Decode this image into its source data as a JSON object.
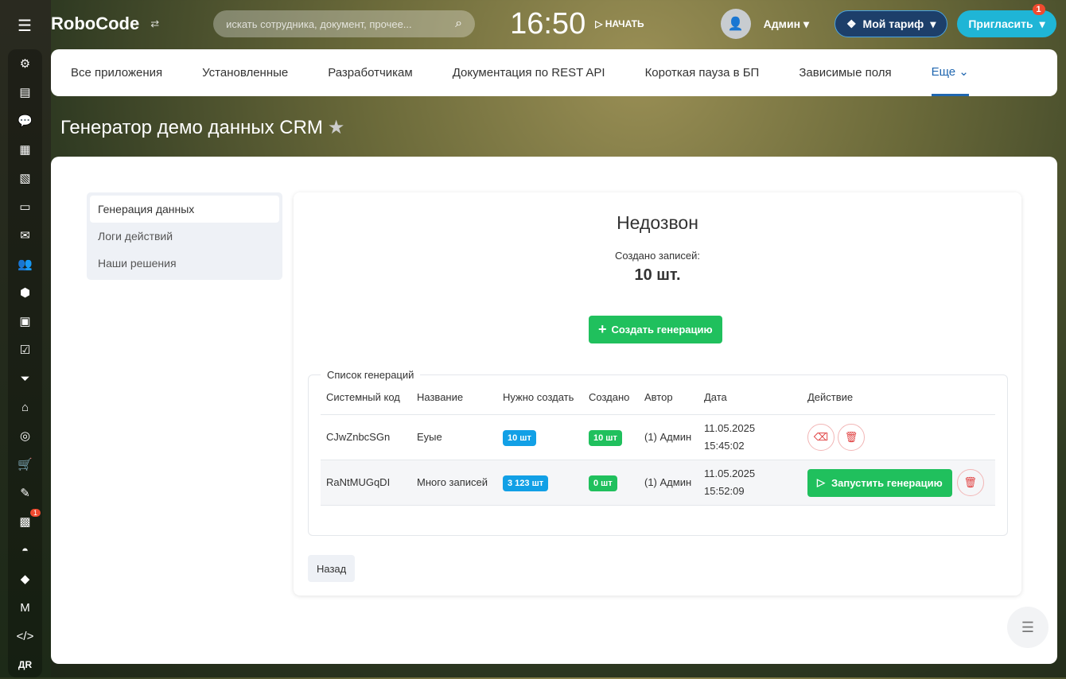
{
  "header": {
    "logo": "RoboCode",
    "search_placeholder": "искать сотрудника, документ, прочее...",
    "clock": "16:50",
    "start": "НАЧАТЬ",
    "user": "Админ",
    "tariff": "Мой тариф",
    "invite": "Пригласить",
    "invite_badge": "1"
  },
  "sidebar": {
    "icons": [
      "sitemap",
      "news",
      "chat",
      "calendar",
      "document",
      "drive",
      "mail",
      "groups",
      "box",
      "training",
      "tasks",
      "filter",
      "store",
      "target",
      "cart",
      "sign",
      "contact",
      "android",
      "cube",
      "marketplace",
      "code",
      "user"
    ],
    "badge": "1",
    "user_initials": "ДR"
  },
  "tabs": [
    "Все приложения",
    "Установленные",
    "Разработчикам",
    "Документация по REST API",
    "Короткая пауза в БП",
    "Зависимые поля",
    "Еще"
  ],
  "page_title": "Генератор демо данных CRM",
  "menu": [
    "Генерация данных",
    "Логи действий",
    "Наши решения"
  ],
  "card": {
    "title": "Недозвон",
    "created_label": "Создано записей:",
    "created_value": "10 шт.",
    "create_button": "Создать генерацию"
  },
  "list": {
    "legend": "Список генераций",
    "headers": [
      "Системный код",
      "Название",
      "Нужно создать",
      "Создано",
      "Автор",
      "Дата",
      "Действие"
    ],
    "rows": [
      {
        "code": "CJwZnbcSGn",
        "name": "Еуые",
        "need": "10 шт",
        "created": "10 шт",
        "author": "(1) Админ",
        "date": "11.05.2025",
        "time": "15:45:02"
      },
      {
        "code": "RaNtMUGqDI",
        "name": "Много записей",
        "need": "3 123 шт",
        "created": "0 шт",
        "author": "(1) Админ",
        "date": "11.05.2025",
        "time": "15:52:09",
        "run": "Запустить генерацию"
      }
    ]
  },
  "back_button": "Назад"
}
